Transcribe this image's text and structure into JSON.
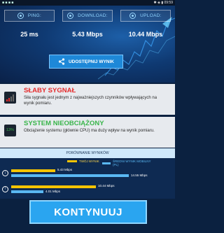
{
  "status_bar": {
    "left": "■ ■ ■ ■",
    "right": "✱ ◈ ▮ 09:59"
  },
  "metrics": [
    {
      "label": "PING:",
      "value": "25 ms",
      "icon": "ping-icon"
    },
    {
      "label": "DOWNLOAD:",
      "value": "5.43 Mbps",
      "icon": "download-icon"
    },
    {
      "label": "UPLOAD:",
      "value": "10.44 Mbps",
      "icon": "upload-icon"
    }
  ],
  "share_button": "UDOSTĘPNIJ WYNIK",
  "signal": {
    "title": "SŁABY SYGNAŁ",
    "title_color": "#e52b2b",
    "description": "Siła sygnału jest jednym z najważniejszych czynników wpływających na wynik pomiaru."
  },
  "system": {
    "badge": "13%",
    "title": "SYSTEM NIEOBCIĄŻONY",
    "title_color": "#39b54a",
    "description": "Obciążenie systemu (głównie CPU) ma duży wpływ na wynik pomiaru."
  },
  "comparison": {
    "header": "PORÓWNANIE WYNIKÓW",
    "legend": {
      "your": "TWÓJ WYNIK",
      "average": "ŚREDNI WYNIK MOBILNY (PL)"
    },
    "colors": {
      "your": "#f6c400",
      "average": "#5ab8f2"
    },
    "download": {
      "your_label": "5.43 Mbps",
      "average_label": "14.55 Mbps",
      "your": 5.43,
      "average": 14.55
    },
    "upload": {
      "your_label": "10.44 Mbps",
      "average_label": "4.01 Mbps",
      "your": 10.44,
      "average": 4.01
    }
  },
  "continue_button": "KONTYNUUJ"
}
